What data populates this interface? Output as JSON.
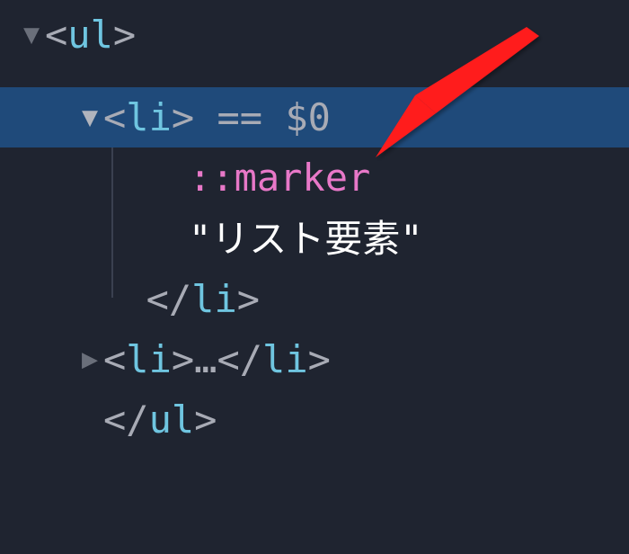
{
  "tree": {
    "row0": {
      "open_punct": "<",
      "tag": "ul",
      "close_punct": ">"
    },
    "row1": {
      "open_punct": "<",
      "tag": "li",
      "close_punct": ">",
      "selected_text": " == $0"
    },
    "row2": {
      "pseudo": "::marker"
    },
    "row3": {
      "text": "\"リスト要素\""
    },
    "row4": {
      "open_punct": "</",
      "tag": "li",
      "close_punct": ">"
    },
    "row5": {
      "open_punct_a": "<",
      "tag_a": "li",
      "close_punct_a": ">",
      "ellipsis": "…",
      "open_punct_b": "</",
      "tag_b": "li",
      "close_punct_b": ">"
    },
    "row6": {
      "open_punct": "</",
      "tag": "ul",
      "close_punct": ">"
    }
  },
  "icons": {
    "disclosure_open": "▼",
    "disclosure_closed": "▶"
  }
}
